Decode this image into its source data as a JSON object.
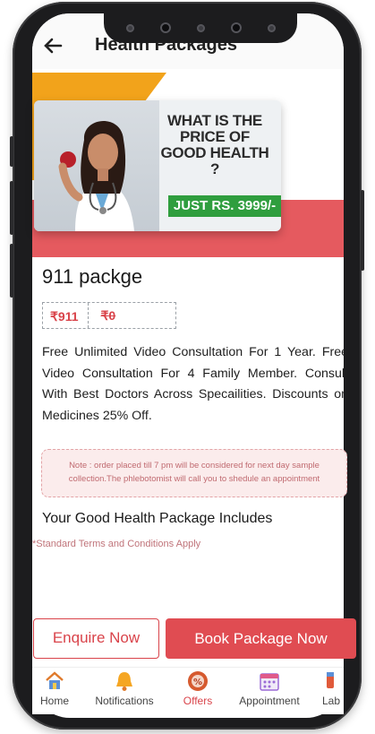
{
  "appbar": {
    "title": "Health Packages"
  },
  "banner": {
    "question": "WHAT IS THE PRICE OF GOOD HEALTH ?",
    "price": "JUST RS. 3999/-"
  },
  "package": {
    "name": "911 packge",
    "price_current": "₹911",
    "price_original": "₹0",
    "description": "Free Unlimited Video Consultation For 1 Year. Free Video Consultation For 4 Family Member. Consult With Best Doctors Across Specailities. Discounts on Medicines 25% Off."
  },
  "note": "Note : order placed till 7 pm will be considered for next day sample collection.The phlebotomist will call you to shedule an appointment",
  "includes_title": "Your Good Health Package Includes",
  "terms": "*Standard Terms and Conditions Apply",
  "buttons": {
    "enquire": "Enquire Now",
    "book": "Book Package Now"
  },
  "tabs": [
    {
      "label": "Home",
      "icon": "home-icon"
    },
    {
      "label": "Notifications",
      "icon": "bell-icon"
    },
    {
      "label": "Offers",
      "icon": "percent-badge-icon",
      "active": true
    },
    {
      "label": "Appointment",
      "icon": "calendar-icon"
    },
    {
      "label": "Lab",
      "icon": "lab-icon"
    }
  ],
  "colors": {
    "accent": "#e04c52",
    "orange": "#f2a31b",
    "green": "#2f9e3e"
  }
}
